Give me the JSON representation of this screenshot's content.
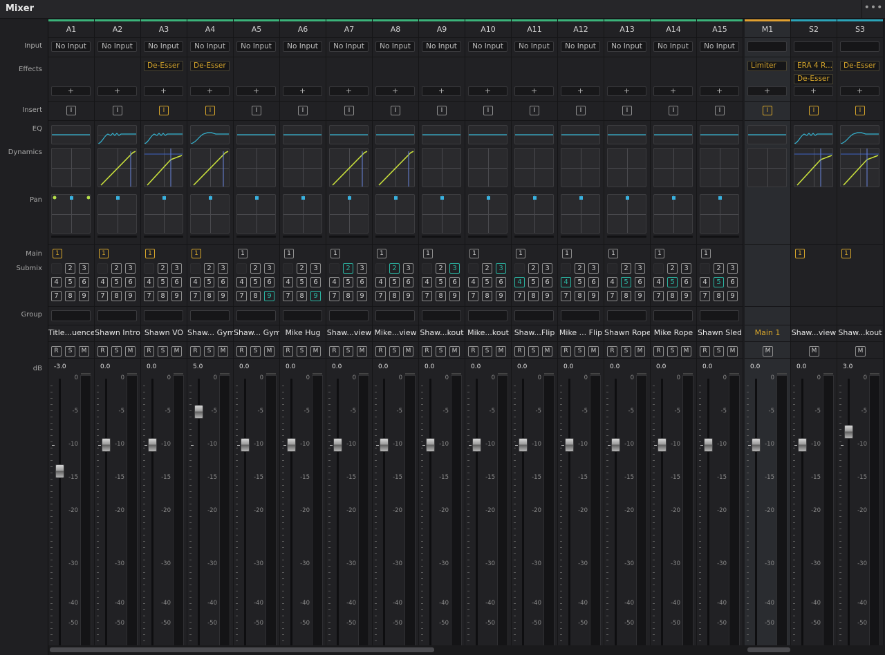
{
  "window": {
    "title": "Mixer",
    "more_icon": "•••"
  },
  "row_labels": {
    "input": "Input",
    "effects": "Effects",
    "insert": "Insert",
    "eq": "EQ",
    "dynamics": "Dynamics",
    "pan": "Pan",
    "main": "Main",
    "submix": "Submix",
    "group": "Group",
    "db": "dB"
  },
  "meter_scale": [
    "0",
    "-5",
    "-10",
    "-15",
    "-20",
    "-30",
    "-40",
    "-50"
  ],
  "colors": {
    "accent_orange": "#d7a62b",
    "teal": "#2bb6a3",
    "track_bar": "#3bb37a",
    "master_bar": "#e0a030",
    "sub_bar": "#2ba4b8",
    "eq_line": "#35b8d6",
    "dyn_line": "#c9e03c"
  },
  "strips": [
    {
      "id": "A1",
      "input": "No Input",
      "effects": [],
      "insert_on": false,
      "eq": "flat",
      "dyn": "none",
      "pan": "stereo",
      "main_on": true,
      "submix_on": [],
      "name": "Title...uence",
      "db": "-3.0",
      "fader_db": -14
    },
    {
      "id": "A2",
      "input": "No Input",
      "effects": [],
      "insert_on": false,
      "eq": "deess",
      "dyn": "comp",
      "pan": "center",
      "main_on": true,
      "submix_on": [],
      "name": "Shawn Intro",
      "db": "0.0",
      "fader_db": -10
    },
    {
      "id": "A3",
      "input": "No Input",
      "effects": [
        "De-Esser"
      ],
      "insert_on": true,
      "eq": "deess",
      "dyn": "comp2",
      "pan": "center",
      "main_on": true,
      "submix_on": [],
      "name": "Shawn VO",
      "db": "0.0",
      "fader_db": -10
    },
    {
      "id": "A4",
      "input": "No Input",
      "effects": [
        "De-Esser"
      ],
      "insert_on": true,
      "eq": "hump",
      "dyn": "comp",
      "pan": "center",
      "main_on": true,
      "submix_on": [],
      "name": "Shaw... Gym",
      "db": "5.0",
      "fader_db": -5
    },
    {
      "id": "A5",
      "input": "No Input",
      "effects": [],
      "insert_on": false,
      "eq": "flat",
      "dyn": "none",
      "pan": "center",
      "main_on": false,
      "submix_on": [
        9
      ],
      "name": "Shaw... Gym",
      "db": "0.0",
      "fader_db": -10
    },
    {
      "id": "A6",
      "input": "No Input",
      "effects": [],
      "insert_on": false,
      "eq": "flat",
      "dyn": "none",
      "pan": "center",
      "main_on": false,
      "submix_on": [
        9
      ],
      "name": "Mike Hug",
      "db": "0.0",
      "fader_db": -10
    },
    {
      "id": "A7",
      "input": "No Input",
      "effects": [],
      "insert_on": false,
      "eq": "flat",
      "dyn": "comp",
      "pan": "center",
      "main_on": false,
      "submix_on": [
        2
      ],
      "name": "Shaw...view",
      "db": "0.0",
      "fader_db": -10
    },
    {
      "id": "A8",
      "input": "No Input",
      "effects": [],
      "insert_on": false,
      "eq": "flat",
      "dyn": "comp",
      "pan": "center",
      "main_on": false,
      "submix_on": [
        2
      ],
      "name": "Mike...view",
      "db": "0.0",
      "fader_db": -10
    },
    {
      "id": "A9",
      "input": "No Input",
      "effects": [],
      "insert_on": false,
      "eq": "flat",
      "dyn": "none",
      "pan": "center",
      "main_on": false,
      "submix_on": [
        3
      ],
      "name": "Shaw...kout",
      "db": "0.0",
      "fader_db": -10
    },
    {
      "id": "A10",
      "input": "No Input",
      "effects": [],
      "insert_on": false,
      "eq": "flat",
      "dyn": "none",
      "pan": "center",
      "main_on": false,
      "submix_on": [
        3
      ],
      "name": "Mike...kout",
      "db": "0.0",
      "fader_db": -10
    },
    {
      "id": "A11",
      "input": "No Input",
      "effects": [],
      "insert_on": false,
      "eq": "flat",
      "dyn": "none",
      "pan": "center",
      "main_on": false,
      "submix_on": [
        4
      ],
      "name": "Shaw...Flip",
      "db": "0.0",
      "fader_db": -10
    },
    {
      "id": "A12",
      "input": "No Input",
      "effects": [],
      "insert_on": false,
      "eq": "flat",
      "dyn": "none",
      "pan": "center",
      "main_on": false,
      "submix_on": [
        4
      ],
      "name": "Mike ... Flip",
      "db": "0.0",
      "fader_db": -10
    },
    {
      "id": "A13",
      "input": "No Input",
      "effects": [],
      "insert_on": false,
      "eq": "flat",
      "dyn": "none",
      "pan": "center",
      "main_on": false,
      "submix_on": [
        5
      ],
      "name": "Shawn Rope",
      "db": "0.0",
      "fader_db": -10
    },
    {
      "id": "A14",
      "input": "No Input",
      "effects": [],
      "insert_on": false,
      "eq": "flat",
      "dyn": "none",
      "pan": "center",
      "main_on": false,
      "submix_on": [
        5
      ],
      "name": "Mike Rope",
      "db": "0.0",
      "fader_db": -10
    },
    {
      "id": "A15",
      "input": "No Input",
      "effects": [],
      "insert_on": false,
      "eq": "flat",
      "dyn": "none",
      "pan": "center",
      "main_on": false,
      "submix_on": [
        5
      ],
      "name": "Shawn Sled",
      "db": "0.0",
      "fader_db": -10
    },
    {
      "id": "M1",
      "input": "",
      "effects": [
        "Limiter"
      ],
      "insert_on": true,
      "eq": "flat",
      "dyn": "none",
      "pan": "none",
      "main_on": null,
      "submix_on": null,
      "name": "Main 1",
      "db": "0.0",
      "fader_db": -10,
      "type": "master"
    },
    {
      "id": "S2",
      "input": "",
      "effects": [
        "ERA 4 R...",
        "De-Esser"
      ],
      "insert_on": true,
      "eq": "deess",
      "dyn": "comp2",
      "pan": "none",
      "main_on": true,
      "submix_on": null,
      "name": "Shaw...view",
      "db": "0.0",
      "fader_db": -10,
      "type": "sub"
    },
    {
      "id": "S3",
      "input": "",
      "effects": [
        "De-Esser"
      ],
      "insert_on": true,
      "eq": "hump",
      "dyn": "comp2",
      "pan": "none",
      "main_on": true,
      "submix_on": null,
      "name": "Shaw...kout",
      "db": "3.0",
      "fader_db": -8,
      "type": "sub"
    }
  ],
  "button_labels": {
    "add": "+",
    "insert": "I",
    "main": "1",
    "rec": "R",
    "solo": "S",
    "mute": "M"
  }
}
